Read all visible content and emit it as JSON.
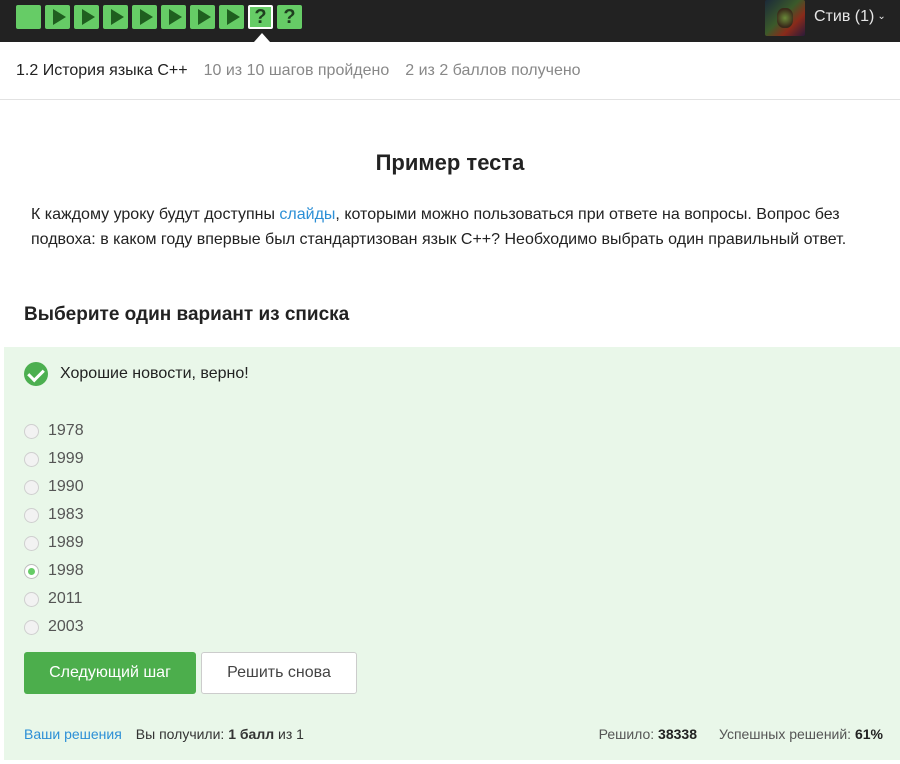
{
  "topbar": {
    "steps": [
      {
        "kind": "plain"
      },
      {
        "kind": "video"
      },
      {
        "kind": "video"
      },
      {
        "kind": "video"
      },
      {
        "kind": "video"
      },
      {
        "kind": "video"
      },
      {
        "kind": "video"
      },
      {
        "kind": "video"
      },
      {
        "kind": "quiz",
        "symbol": "?",
        "current": true
      },
      {
        "kind": "quiz",
        "symbol": "?"
      }
    ],
    "step_color": "#66cc66",
    "user_label": "Стив (1)",
    "user_chevron": "⌄",
    "avatar_icon": "user-avatar-icon"
  },
  "lesson": {
    "title": "1.2 История языка C++",
    "progress": "10 из 10 шагов пройдено",
    "score": "2 из 2 баллов  получено"
  },
  "content": {
    "title": "Пример теста",
    "intro_before_link": "К каждому уроку будут доступны ",
    "intro_link": "слайды",
    "intro_after_link": ", которыми можно пользоваться при ответе на вопросы. Вопрос без подвоха: в каком году впервые был стандартизован язык C++? Необходимо выбрать один правильный ответ."
  },
  "quiz": {
    "heading": "Выберите один вариант из списка",
    "feedback": "Хорошие новости, верно!",
    "options": [
      "1978",
      "1999",
      "1990",
      "1983",
      "1989",
      "1998",
      "2011",
      "2003"
    ],
    "selected": "1998",
    "next_button": "Следующий шаг",
    "retry_button": "Решить снова"
  },
  "footer": {
    "solutions_link": "Ваши решения",
    "received_prefix": "Вы получили: ",
    "received_value": "1 балл",
    "received_suffix": " из 1",
    "solved_label": "Решило: ",
    "solved_value": "38338",
    "success_label": "Успешных решений: ",
    "success_value": "61%"
  },
  "colors": {
    "accent_green": "#4cae4c",
    "panel_bg": "#e9f7e9",
    "link_blue": "#2c8fd6",
    "topbar_bg": "#222222"
  }
}
